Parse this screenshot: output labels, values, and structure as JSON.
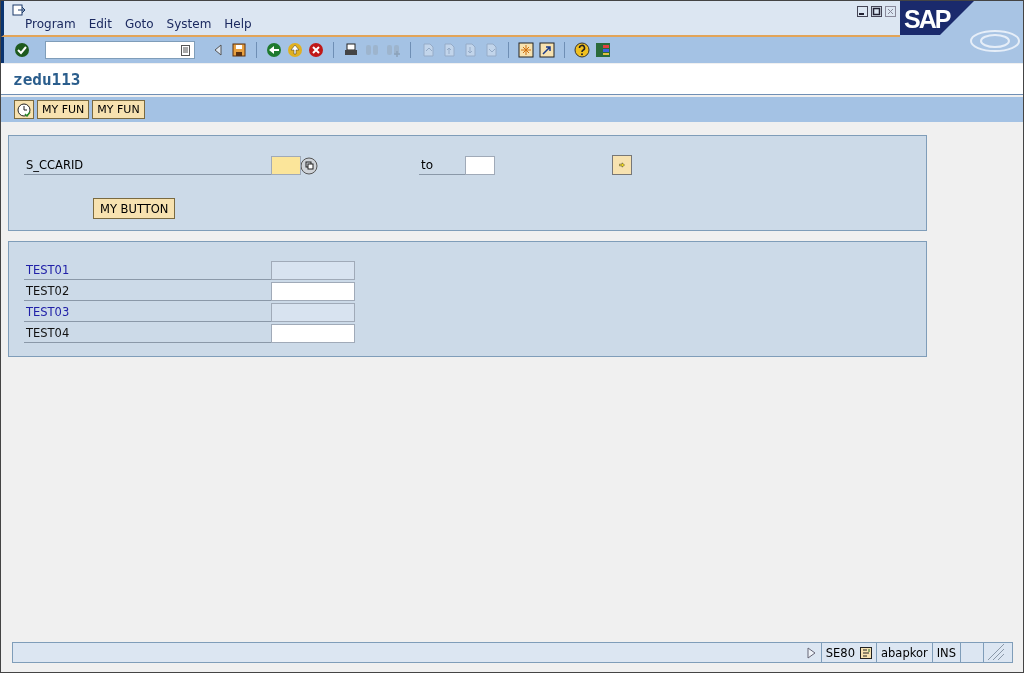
{
  "menu": [
    {
      "label": "Program"
    },
    {
      "label": "Edit"
    },
    {
      "label": "Goto"
    },
    {
      "label": "System"
    },
    {
      "label": "Help"
    }
  ],
  "toolbar": [
    [
      {
        "kind": "enter",
        "disabled": false
      },
      {
        "kind": "command-field"
      },
      {
        "kind": "collapse",
        "disabled": false
      },
      {
        "kind": "save",
        "disabled": false
      }
    ],
    [
      {
        "kind": "back",
        "disabled": false
      },
      {
        "kind": "exit",
        "disabled": false
      },
      {
        "kind": "cancel",
        "disabled": false
      }
    ],
    [
      {
        "kind": "print",
        "disabled": false
      },
      {
        "kind": "find",
        "disabled": true
      },
      {
        "kind": "find-next",
        "disabled": true
      }
    ],
    [
      {
        "kind": "first-page",
        "disabled": true
      },
      {
        "kind": "previous-page",
        "disabled": true
      },
      {
        "kind": "next-page",
        "disabled": true
      },
      {
        "kind": "last-page",
        "disabled": true
      }
    ],
    [
      {
        "kind": "new-session",
        "disabled": false
      },
      {
        "kind": "shortcut",
        "disabled": false
      }
    ],
    [
      {
        "kind": "help",
        "disabled": false
      },
      {
        "kind": "layout",
        "disabled": false
      }
    ]
  ],
  "logo": "SAP",
  "title": "zedu113",
  "app_toolbar": [
    {
      "kind": "execute"
    },
    {
      "kind": "text",
      "label": "MY FUN"
    },
    {
      "kind": "text",
      "label": "MY FUN"
    }
  ],
  "selection_block": {
    "label": "S_CCARID",
    "low": {
      "highlighted": true
    },
    "to_label": "to",
    "high": {
      "highlighted": false
    },
    "button": "MY BUTTON"
  },
  "fields": [
    {
      "label": "TEST01",
      "disabled": true
    },
    {
      "label": "TEST02",
      "disabled": false
    },
    {
      "label": "TEST03",
      "disabled": true
    },
    {
      "label": "TEST04",
      "disabled": false
    }
  ],
  "status_bar": {
    "transaction": "SE80",
    "user": "abapkor",
    "mode": "INS"
  }
}
